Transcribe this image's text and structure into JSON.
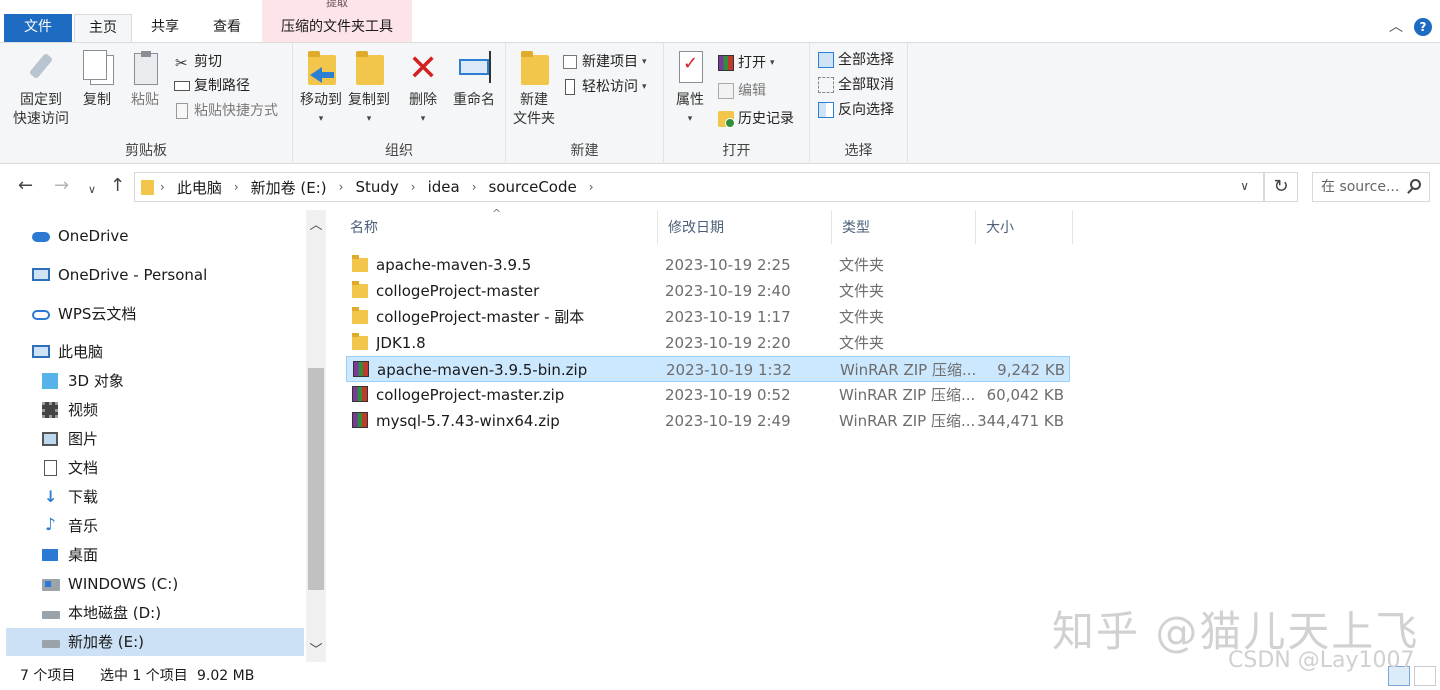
{
  "tabs": {
    "context_header": "提取",
    "file": "文件",
    "home": "主页",
    "share": "共享",
    "view": "查看",
    "compressed_tools": "压缩的文件夹工具",
    "help": "?"
  },
  "ribbon": {
    "clipboard": {
      "label": "剪贴板",
      "pin_line1": "固定到",
      "pin_line2": "快速访问",
      "copy": "复制",
      "paste": "粘贴",
      "cut": "剪切",
      "copy_path": "复制路径",
      "paste_shortcut": "粘贴快捷方式"
    },
    "organize": {
      "label": "组织",
      "move_to": "移动到",
      "copy_to": "复制到",
      "delete": "删除",
      "rename": "重命名"
    },
    "new": {
      "label": "新建",
      "new_folder_line1": "新建",
      "new_folder_line2": "文件夹",
      "new_item": "新建项目",
      "easy_access": "轻松访问"
    },
    "open": {
      "label": "打开",
      "properties": "属性",
      "open": "打开",
      "edit": "编辑",
      "history": "历史记录"
    },
    "select": {
      "label": "选择",
      "select_all": "全部选择",
      "select_none": "全部取消",
      "invert": "反向选择"
    }
  },
  "address": {
    "crumbs": [
      "此电脑",
      "新加卷 (E:)",
      "Study",
      "idea",
      "sourceCode"
    ],
    "search_placeholder": "在 source..."
  },
  "nav": {
    "items": [
      {
        "label": "OneDrive"
      },
      {
        "label": "OneDrive - Personal"
      },
      {
        "label": "WPS云文档"
      },
      {
        "label": "此电脑"
      },
      {
        "label": "3D 对象"
      },
      {
        "label": "视频"
      },
      {
        "label": "图片"
      },
      {
        "label": "文档"
      },
      {
        "label": "下载"
      },
      {
        "label": "音乐"
      },
      {
        "label": "桌面"
      },
      {
        "label": "WINDOWS (C:)"
      },
      {
        "label": "本地磁盘 (D:)"
      },
      {
        "label": "新加卷 (E:)"
      }
    ]
  },
  "columns": {
    "name": "名称",
    "date": "修改日期",
    "type": "类型",
    "size": "大小"
  },
  "files": [
    {
      "name": "apache-maven-3.9.5",
      "date": "2023-10-19 2:25",
      "type": "文件夹",
      "size": "",
      "kind": "folder"
    },
    {
      "name": "collogeProject-master",
      "date": "2023-10-19 2:40",
      "type": "文件夹",
      "size": "",
      "kind": "folder"
    },
    {
      "name": "collogeProject-master - 副本",
      "date": "2023-10-19 1:17",
      "type": "文件夹",
      "size": "",
      "kind": "folder"
    },
    {
      "name": "JDK1.8",
      "date": "2023-10-19 2:20",
      "type": "文件夹",
      "size": "",
      "kind": "folder"
    },
    {
      "name": "apache-maven-3.9.5-bin.zip",
      "date": "2023-10-19 1:32",
      "type": "WinRAR ZIP 压缩...",
      "size": "9,242 KB",
      "kind": "zip",
      "selected": true
    },
    {
      "name": "collogeProject-master.zip",
      "date": "2023-10-19 0:52",
      "type": "WinRAR ZIP 压缩...",
      "size": "60,042 KB",
      "kind": "zip"
    },
    {
      "name": "mysql-5.7.43-winx64.zip",
      "date": "2023-10-19 2:49",
      "type": "WinRAR ZIP 压缩...",
      "size": "344,471 KB",
      "kind": "zip"
    }
  ],
  "status": {
    "count": "7 个项目",
    "selected": "选中 1 个项目",
    "size": "9.02 MB"
  },
  "watermarks": {
    "zhihu": "知乎 @猫儿天上飞",
    "csdn": "CSDN @Lay1007"
  }
}
